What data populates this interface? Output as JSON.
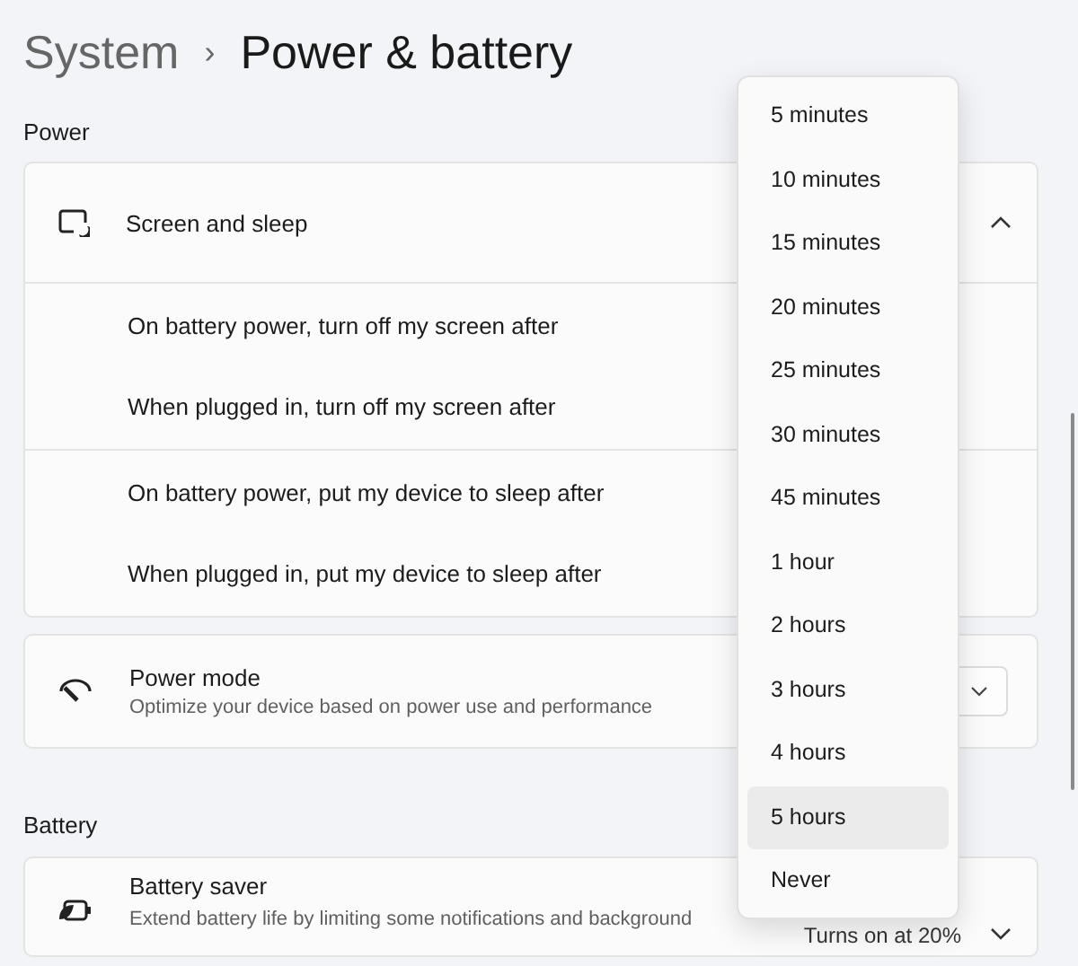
{
  "breadcrumb": {
    "parent": "System",
    "separator": "›",
    "current": "Power & battery"
  },
  "power": {
    "title": "Power",
    "screen_sleep": {
      "title": "Screen and sleep",
      "expanded": true,
      "groups": [
        {
          "settings": [
            "On battery power, turn off my screen after",
            "When plugged in, turn off my screen after"
          ]
        },
        {
          "settings": [
            "On battery power, put my device to sleep after",
            "When plugged in, put my device to sleep after"
          ]
        }
      ]
    },
    "power_mode": {
      "title": "Power mode",
      "description": "Optimize your device based on power use and performance"
    }
  },
  "battery": {
    "title": "Battery",
    "battery_saver": {
      "title": "Battery saver",
      "description": "Extend battery life by limiting some notifications and background",
      "status": "Turns on at 20%",
      "expanded": false
    }
  },
  "dropdown": {
    "options": [
      {
        "label": "5 minutes",
        "selected": false
      },
      {
        "label": "10 minutes",
        "selected": false
      },
      {
        "label": "15 minutes",
        "selected": false
      },
      {
        "label": "20 minutes",
        "selected": false
      },
      {
        "label": "25 minutes",
        "selected": false
      },
      {
        "label": "30 minutes",
        "selected": false
      },
      {
        "label": "45 minutes",
        "selected": false
      },
      {
        "label": "1 hour",
        "selected": false
      },
      {
        "label": "2 hours",
        "selected": false
      },
      {
        "label": "3 hours",
        "selected": false
      },
      {
        "label": "4 hours",
        "selected": false
      },
      {
        "label": "5 hours",
        "selected": true
      },
      {
        "label": "Never",
        "selected": false
      }
    ]
  }
}
